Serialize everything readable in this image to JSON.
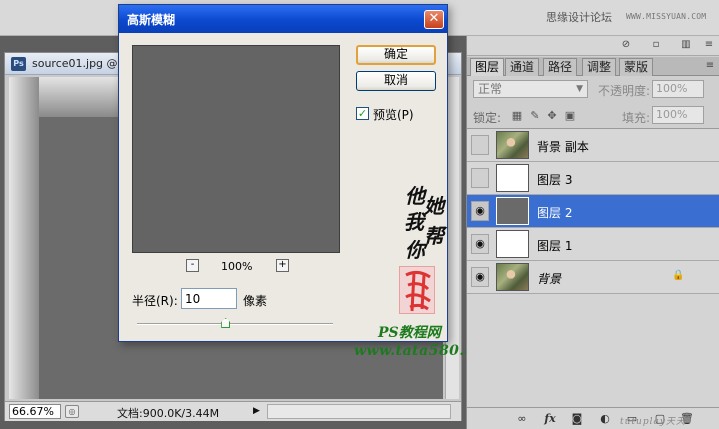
{
  "topbar": {
    "forum_label": "思缘设计论坛",
    "forum_url": "WWW.MISSYUAN.COM"
  },
  "document": {
    "title": "source01.jpg @",
    "zoom": "66.67%",
    "info": "文档:900.0K/3.44M"
  },
  "dialog": {
    "title": "高斯模糊",
    "ok_label": "确定",
    "cancel_label": "取消",
    "preview_label": "预览(P)",
    "preview_checked": "✓",
    "zoom_percent": "100%",
    "zoom_minus": "-",
    "zoom_plus": "+",
    "radius_label": "半径(R):",
    "radius_value": "10",
    "radius_unit": "像素",
    "slider_position": 0.45
  },
  "watermark": {
    "calligraphy": [
      "他",
      "她",
      "我",
      "帮",
      "你"
    ],
    "site_name": "PS教程网",
    "site_url": "www.tata580.com",
    "footer_text": "tutuplay天天"
  },
  "layers_panel": {
    "tabs": [
      {
        "label": "图层",
        "active": true
      },
      {
        "label": "通道",
        "active": false
      },
      {
        "label": "路径",
        "active": false
      },
      {
        "label": "调整",
        "active": false
      },
      {
        "label": "蒙版",
        "active": false
      }
    ],
    "blend_mode": "正常",
    "opacity_label": "不透明度:",
    "opacity_value": "100%",
    "lock_label": "锁定:",
    "fill_label": "填充:",
    "fill_value": "100%",
    "layers": [
      {
        "name": "背景 副本",
        "visible": false,
        "thumb": "photo",
        "selected": false
      },
      {
        "name": "图层 3",
        "visible": false,
        "thumb": "white",
        "selected": false
      },
      {
        "name": "图层 2",
        "visible": true,
        "thumb": "gray",
        "selected": true
      },
      {
        "name": "图层 1",
        "visible": true,
        "thumb": "white",
        "selected": false
      },
      {
        "name": "背景",
        "visible": true,
        "thumb": "photo",
        "selected": false,
        "locked": true
      }
    ],
    "footer_icons": [
      "link-icon",
      "fx-icon",
      "mask-icon",
      "adjustment-icon",
      "group-icon",
      "new-layer-icon",
      "trash-icon"
    ]
  },
  "colors": {
    "selection": "#3a6fd1",
    "dialog_title": "#0b49d0"
  }
}
